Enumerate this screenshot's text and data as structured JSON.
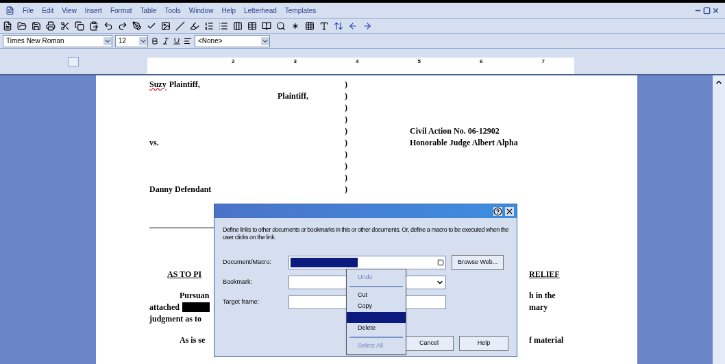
{
  "menu_bar": [
    "File",
    "Edit",
    "View",
    "Insert",
    "Format",
    "Table",
    "Tools",
    "Window",
    "Help",
    "Letterhead",
    "Templates"
  ],
  "formatting": {
    "font": "Times New Roman",
    "size": "12",
    "style": "<None>"
  },
  "ruler": {
    "numbers": [
      "2",
      "3",
      "4",
      "5",
      "6",
      "7"
    ]
  },
  "document": {
    "caption": [
      {
        "kind": "plain",
        "flagged_word": "Suzy",
        "left": "Plaintiff,"
      },
      {
        "kind": "indented",
        "left": "Plaintiff,"
      },
      {
        "kind": "blank"
      },
      {
        "kind": "blank"
      },
      {
        "kind": "plain",
        "right": "Civil Action No. 06-12902"
      },
      {
        "kind": "plain",
        "left": "vs.",
        "right": "Honorable Judge Albert Alpha"
      },
      {
        "kind": "blank"
      },
      {
        "kind": "blank"
      },
      {
        "kind": "blank"
      },
      {
        "kind": "plain",
        "left": "Danny Defendant"
      }
    ],
    "brace": ")",
    "body": [
      {
        "left": "AS TO PI",
        "right": "RELIEF",
        "kind": "heading"
      },
      {
        "left": "Pursuan",
        "right": "h in the",
        "kind": "indent"
      },
      {
        "left": "attached",
        "right": "mary",
        "kind": "redacted"
      },
      {
        "left": "judgment as to",
        "kind": "plain"
      },
      {
        "left": "As is se",
        "right": "f material",
        "kind": "indent"
      }
    ]
  },
  "dialog": {
    "description": "Define links to other documents or bookmarks in this or other documents. Or, define a macro to be executed when the user clicks on the link.",
    "fields": [
      {
        "label": "Document/Macro:",
        "kind": "macro"
      },
      {
        "label": "Bookmark:",
        "kind": "combo"
      },
      {
        "label": "Target frame:",
        "kind": "text"
      }
    ],
    "browse_button": "Browse Web...",
    "buttons": [
      "Cancel",
      "Help"
    ]
  },
  "context_menu": [
    {
      "kind": "item",
      "label": "Undo",
      "disabled": true,
      "selected": false
    },
    {
      "kind": "separator"
    },
    {
      "kind": "item",
      "label": "Cut",
      "disabled": false,
      "selected": false
    },
    {
      "kind": "item",
      "label": "Copy",
      "disabled": false,
      "selected": false
    },
    {
      "kind": "item",
      "disabled": false,
      "selected": true
    },
    {
      "kind": "item",
      "label": "Delete",
      "disabled": false,
      "selected": false
    },
    {
      "kind": "separator"
    },
    {
      "kind": "item",
      "label": "Select All",
      "disabled": true,
      "selected": false
    }
  ]
}
